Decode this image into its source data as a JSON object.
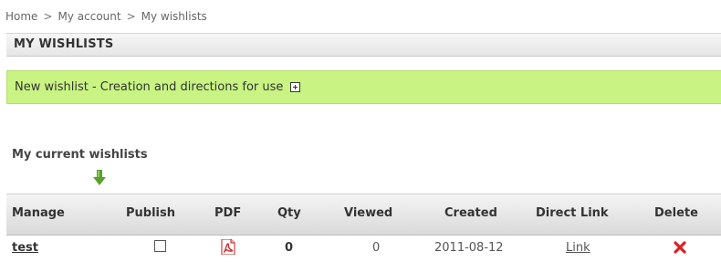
{
  "breadcrumb": {
    "items": [
      "Home",
      "My account",
      "My wishlists"
    ],
    "separator": ">"
  },
  "header": {
    "title": "MY WISHLISTS"
  },
  "new_wishlist": {
    "label": "New wishlist - Creation and directions for use"
  },
  "section": {
    "title": "My current wishlists"
  },
  "table": {
    "columns": [
      "Manage",
      "Publish",
      "PDF",
      "Qty",
      "Viewed",
      "Created",
      "Direct Link",
      "Delete"
    ],
    "rows": [
      {
        "name": "test",
        "published": false,
        "qty": "0",
        "viewed": "0",
        "created": "2011-08-12",
        "direct_link": "Link"
      }
    ]
  },
  "colors": {
    "green_bar": "#c9f483",
    "arrow": "#5aa02c",
    "delete": "#e02020",
    "pdf": "#cc1f1f"
  },
  "icons": {
    "expand": "plus-box-icon",
    "arrow": "down-arrow-icon",
    "pdf": "pdf-file-icon",
    "delete": "red-x-icon"
  }
}
